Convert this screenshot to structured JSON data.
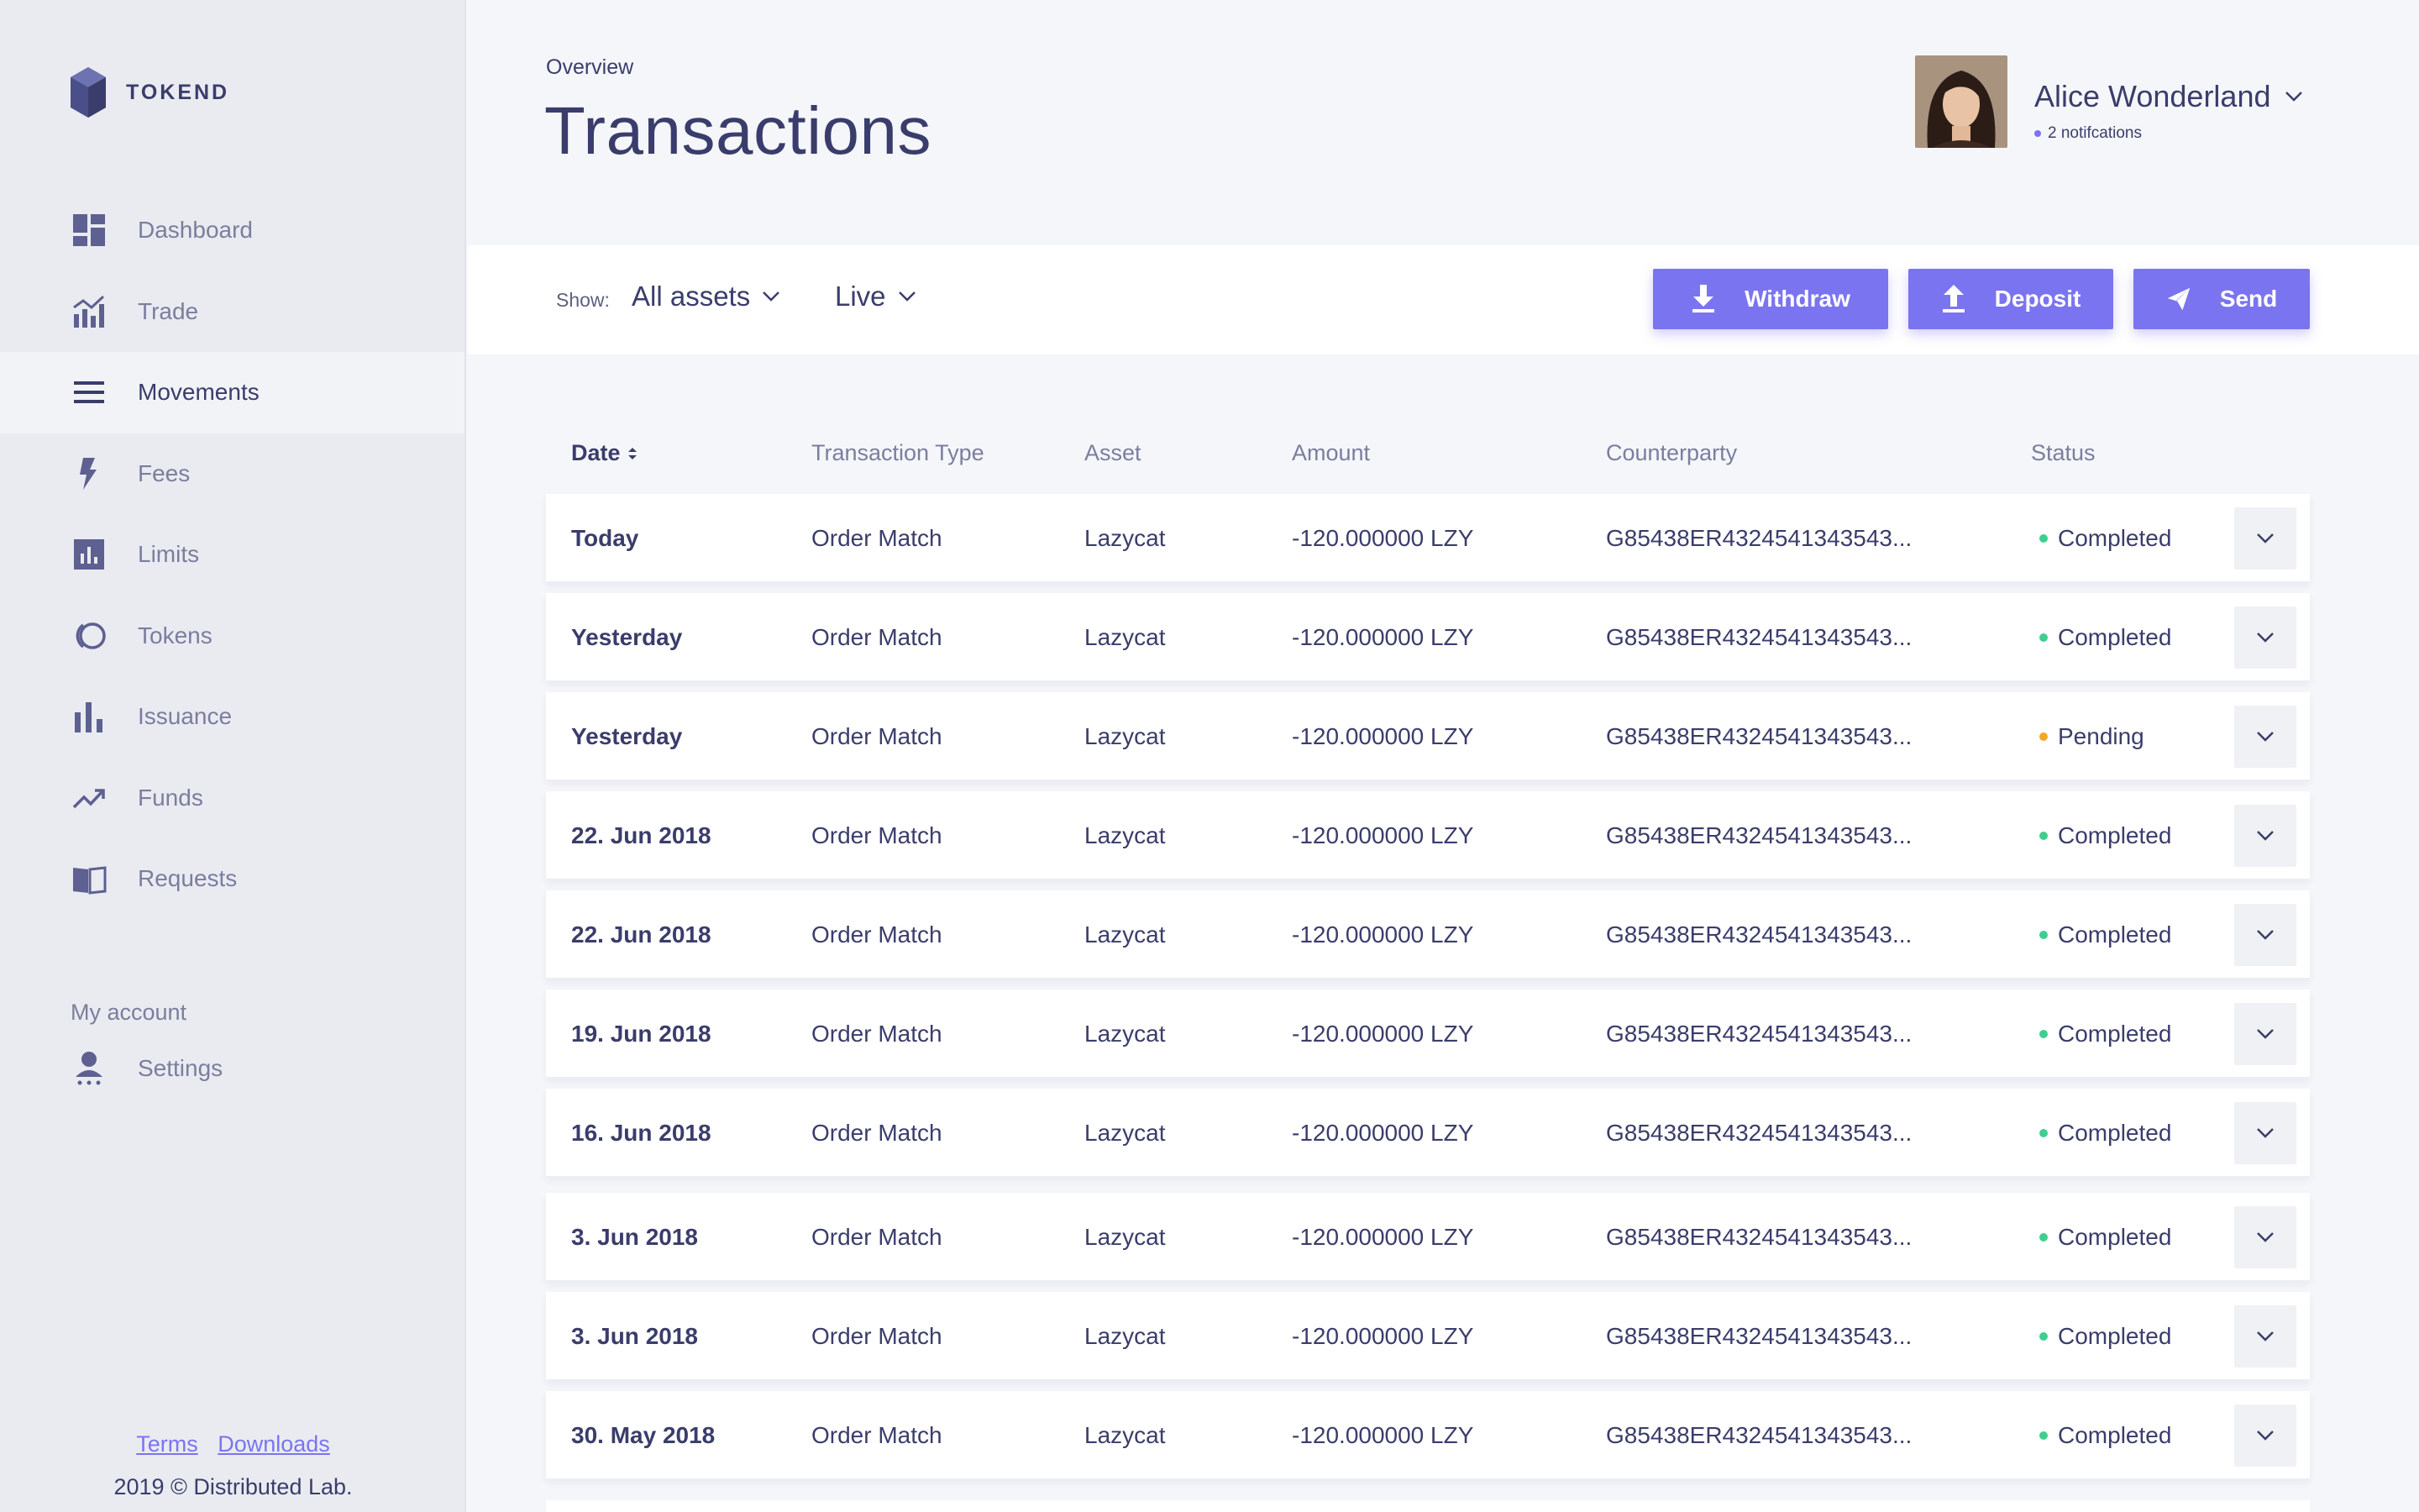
{
  "brand": {
    "name": "TOKEND"
  },
  "sidebar": {
    "items": [
      {
        "label": "Dashboard",
        "icon": "dashboard-icon",
        "active": false
      },
      {
        "label": "Trade",
        "icon": "trade-chart-icon",
        "active": false
      },
      {
        "label": "Movements",
        "icon": "menu-lines-icon",
        "active": true
      },
      {
        "label": "Fees",
        "icon": "lightning-icon",
        "active": false
      },
      {
        "label": "Limits",
        "icon": "bar-square-icon",
        "active": false
      },
      {
        "label": "Tokens",
        "icon": "tokens-icon",
        "active": false
      },
      {
        "label": "Issuance",
        "icon": "issuance-bars-icon",
        "active": false
      },
      {
        "label": "Funds",
        "icon": "trending-up-icon",
        "active": false
      },
      {
        "label": "Requests",
        "icon": "book-icon",
        "active": false
      }
    ],
    "account_section_title": "My account",
    "settings_label": "Settings",
    "footer": {
      "terms": "Terms",
      "downloads": "Downloads",
      "copyright": "2019 © Distributed Lab."
    }
  },
  "header": {
    "breadcrumb": "Overview",
    "title": "Transactions",
    "user": {
      "name": "Alice Wonderland",
      "notifications": "2 notifcations"
    }
  },
  "toolbar": {
    "show_label": "Show:",
    "asset_filter": "All assets",
    "mode_filter": "Live",
    "buttons": {
      "withdraw": "Withdraw",
      "deposit": "Deposit",
      "send": "Send"
    }
  },
  "table": {
    "columns": [
      "Date",
      "Transaction Type",
      "Asset",
      "Amount",
      "Counterparty",
      "Status"
    ],
    "rows": [
      {
        "date": "Today",
        "type": "Order Match",
        "asset": "Lazycat",
        "amount": "-120.000000 LZY",
        "counterparty": "G85438ER4324541343543...",
        "status": "Completed"
      },
      {
        "date": "Yesterday",
        "type": "Order Match",
        "asset": "Lazycat",
        "amount": "-120.000000 LZY",
        "counterparty": "G85438ER4324541343543...",
        "status": "Completed"
      },
      {
        "date": "Yesterday",
        "type": "Order Match",
        "asset": "Lazycat",
        "amount": "-120.000000 LZY",
        "counterparty": "G85438ER4324541343543...",
        "status": "Pending"
      },
      {
        "date": "22. Jun 2018",
        "type": "Order Match",
        "asset": "Lazycat",
        "amount": "-120.000000 LZY",
        "counterparty": "G85438ER4324541343543...",
        "status": "Completed"
      },
      {
        "date": "22. Jun 2018",
        "type": "Order Match",
        "asset": "Lazycat",
        "amount": "-120.000000 LZY",
        "counterparty": "G85438ER4324541343543...",
        "status": "Completed"
      },
      {
        "date": "19. Jun 2018",
        "type": "Order Match",
        "asset": "Lazycat",
        "amount": "-120.000000 LZY",
        "counterparty": "G85438ER4324541343543...",
        "status": "Completed"
      },
      {
        "date": "16. Jun 2018",
        "type": "Order Match",
        "asset": "Lazycat",
        "amount": "-120.000000 LZY",
        "counterparty": "G85438ER4324541343543...",
        "status": "Completed"
      },
      {
        "date": "3. Jun 2018",
        "type": "Order Match",
        "asset": "Lazycat",
        "amount": "-120.000000 LZY",
        "counterparty": "G85438ER4324541343543...",
        "status": "Completed"
      },
      {
        "date": "3. Jun 2018",
        "type": "Order Match",
        "asset": "Lazycat",
        "amount": "-120.000000 LZY",
        "counterparty": "G85438ER4324541343543...",
        "status": "Completed"
      },
      {
        "date": "30. May 2018",
        "type": "Order Match",
        "asset": "Lazycat",
        "amount": "-120.000000 LZY",
        "counterparty": "G85438ER4324541343543...",
        "status": "Completed"
      }
    ]
  },
  "colors": {
    "accent": "#7b74f0",
    "completed": "#3ecf8e",
    "pending": "#f5a623",
    "text": "#3a3d6b",
    "muted": "#7b7e9d"
  }
}
